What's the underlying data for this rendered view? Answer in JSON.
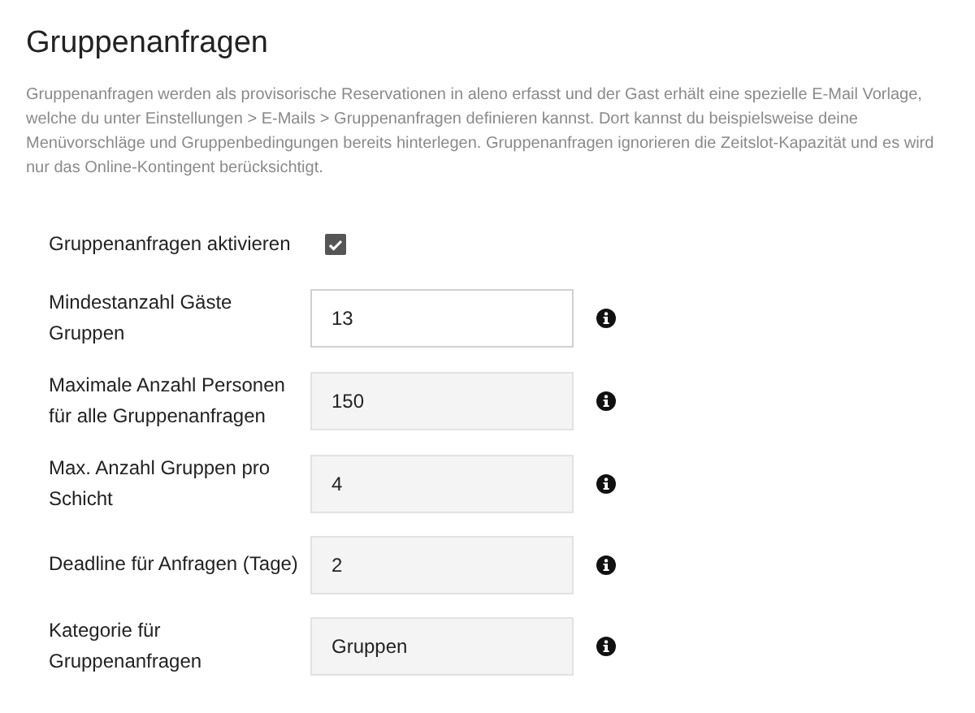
{
  "title": "Gruppenanfragen",
  "description": "Gruppenanfragen werden als provisorische Reservationen in aleno erfasst und der Gast erhält eine spezielle E-Mail Vorlage, welche du unter Einstellungen > E-Mails > Gruppenanfragen definieren kannst. Dort kannst du beispielsweise deine Menüvorschläge und Gruppenbedingungen bereits hinterlegen. Gruppenanfragen ignorieren die Zeitslot-Kapazität und es wird nur das Online-Kontingent berücksichtigt.",
  "settings": [
    {
      "kind": "checkbox",
      "label": "Gruppenanfragen aktivieren",
      "checked": true
    },
    {
      "kind": "field",
      "label": "Mindestanzahl Gäste Gruppen",
      "value": "13",
      "focused": true
    },
    {
      "kind": "field",
      "label": "Maximale Anzahl Personen für alle Gruppenanfragen",
      "value": "150",
      "focused": false
    },
    {
      "kind": "field",
      "label": "Max. Anzahl Gruppen pro Schicht",
      "value": "4",
      "focused": false
    },
    {
      "kind": "field",
      "label": "Deadline für Anfragen (Tage)",
      "value": "2",
      "focused": false
    },
    {
      "kind": "field",
      "label": "Kategorie für Gruppenanfragen",
      "value": "Gruppen",
      "focused": false
    }
  ]
}
